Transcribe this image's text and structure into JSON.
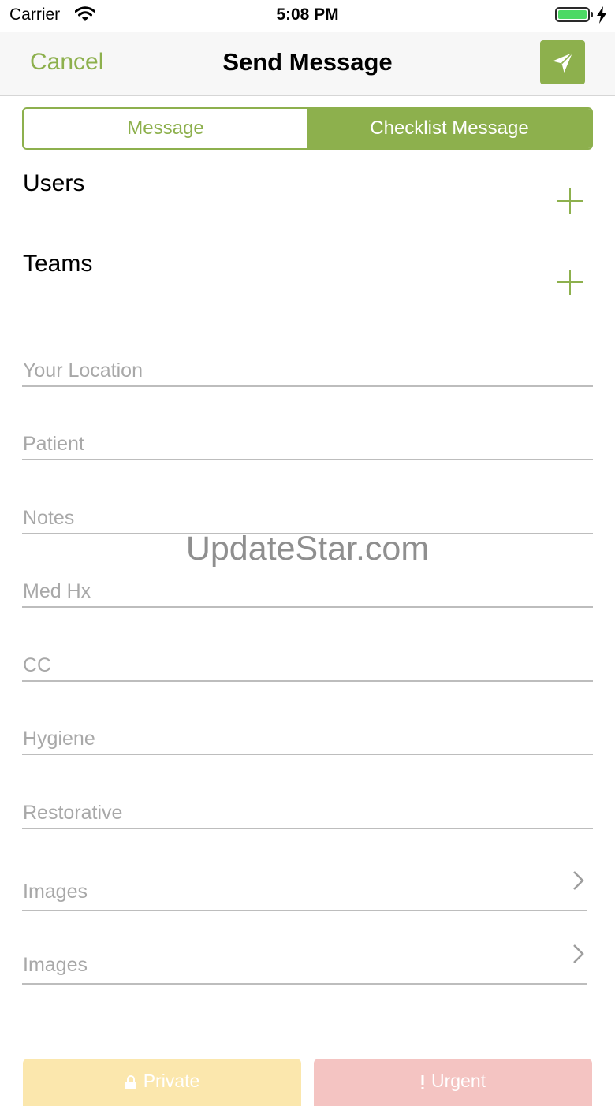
{
  "status_bar": {
    "carrier": "Carrier",
    "time": "5:08 PM",
    "battery_color": "#4cd964"
  },
  "nav": {
    "cancel_label": "Cancel",
    "title": "Send Message",
    "send_icon": "send-icon"
  },
  "segment": {
    "options": [
      "Message",
      "Checklist Message"
    ],
    "selected": "Checklist Message"
  },
  "sections": {
    "users_label": "Users",
    "teams_label": "Teams"
  },
  "fields": {
    "location_placeholder": "Your Location",
    "patient_placeholder": "Patient",
    "notes_placeholder": "Notes",
    "medhx_placeholder": "Med Hx",
    "cc_placeholder": "CC",
    "hygiene_placeholder": "Hygiene",
    "restorative_placeholder": "Restorative"
  },
  "attachments": {
    "images_1_label": "Images",
    "images_2_label": "Images"
  },
  "watermark": "UpdateStar.com",
  "buttons": {
    "private_label": "Private",
    "urgent_label": "Urgent"
  },
  "colors": {
    "accent": "#8db04d",
    "private_bg": "#fbe7ad",
    "urgent_bg": "#f4c4c2"
  }
}
